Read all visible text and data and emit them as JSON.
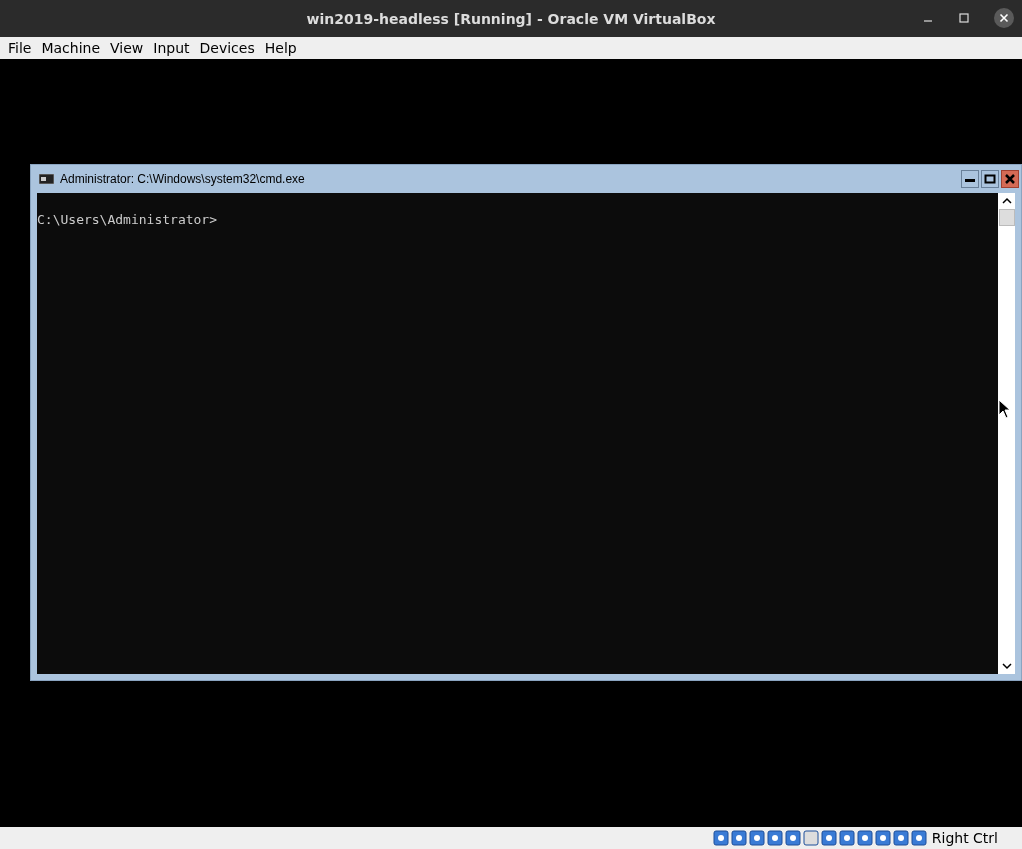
{
  "window": {
    "title": "win2019-headless [Running] - Oracle VM VirtualBox"
  },
  "menu": [
    "File",
    "Machine",
    "View",
    "Input",
    "Devices",
    "Help"
  ],
  "guest": {
    "console": {
      "title": "Administrator: C:\\Windows\\system32\\cmd.exe",
      "prompt": "C:\\Users\\Administrator>"
    }
  },
  "status_bar": {
    "host_key": "Right Ctrl"
  }
}
